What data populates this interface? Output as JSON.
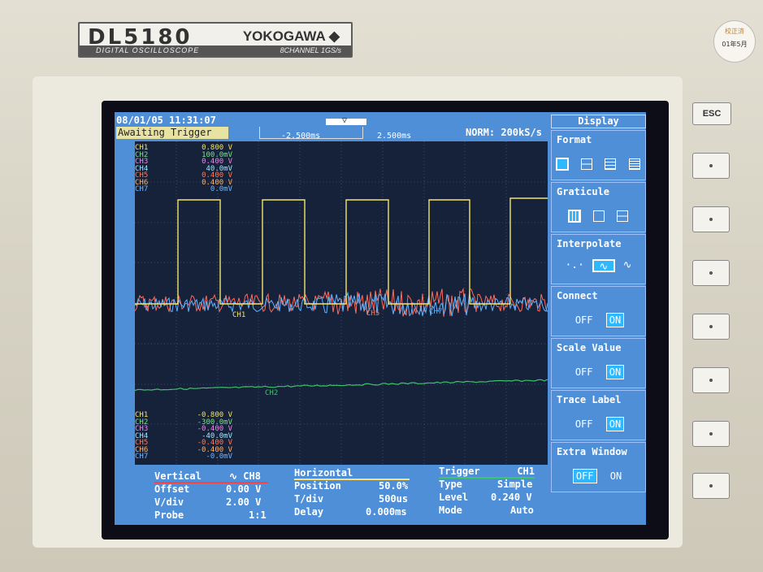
{
  "device": {
    "model": "DL5180",
    "maker": "YOKOGAWA",
    "subtitle_left": "DIGITAL OSCILLOSCOPE",
    "subtitle_right": "8CHANNEL 1GS/s",
    "sticker_lines": [
      "校正済",
      "01年5月"
    ],
    "esc_label": "ESC"
  },
  "header": {
    "datetime": "08/01/05 11:31:07",
    "status": "Awaiting Trigger",
    "time_left": "-2.500ms",
    "time_right": "2.500ms",
    "acq": "NORM: 200kS/s"
  },
  "top_channels": [
    {
      "name": "CH1",
      "value": "0.800 V",
      "color": "#f2e46a"
    },
    {
      "name": "CH2",
      "value": "100.0mV",
      "color": "#7ee08a"
    },
    {
      "name": "CH3",
      "value": "0.400 V",
      "color": "#e98be6"
    },
    {
      "name": "CH4",
      "value": "40.0mV",
      "color": "#9fe8ff"
    },
    {
      "name": "CH5",
      "value": "0.400 V",
      "color": "#ff7b55"
    },
    {
      "name": "CH6",
      "value": "0.400 V",
      "color": "#ffb36a"
    },
    {
      "name": "CH7",
      "value": "0.0mV",
      "color": "#6fb8ff"
    }
  ],
  "bottom_channels": [
    {
      "name": "CH1",
      "value": "-0.800 V",
      "color": "#f2e46a"
    },
    {
      "name": "CH2",
      "value": "-300.0mV",
      "color": "#7ee08a"
    },
    {
      "name": "CH3",
      "value": "-0.400 V",
      "color": "#e98be6"
    },
    {
      "name": "CH4",
      "value": "-40.0mV",
      "color": "#9fe8ff"
    },
    {
      "name": "CH5",
      "value": "-0.400 V",
      "color": "#ff7b55"
    },
    {
      "name": "CH6",
      "value": "-0.400 V",
      "color": "#ffb36a"
    },
    {
      "name": "CH7",
      "value": "-0.0mV",
      "color": "#6fb8ff"
    }
  ],
  "trace_labels": {
    "ch1": "CH1",
    "ch5": "CH5",
    "ch7": "CH7",
    "ch2": "CH2"
  },
  "sidebar": {
    "title": "Display",
    "format": {
      "label": "Format"
    },
    "graticule": {
      "label": "Graticule"
    },
    "interpolate": {
      "label": "Interpolate"
    },
    "connect": {
      "label": "Connect",
      "off": "OFF",
      "on": "ON",
      "selected": "ON"
    },
    "scale_value": {
      "label": "Scale Value",
      "off": "OFF",
      "on": "ON",
      "selected": "ON"
    },
    "trace_label": {
      "label": "Trace Label",
      "off": "OFF",
      "on": "ON",
      "selected": "ON"
    },
    "extra_window": {
      "label": "Extra Window",
      "off": "OFF",
      "on": "ON",
      "selected": "OFF"
    }
  },
  "vertical": {
    "title": "Vertical",
    "channel": "CH8",
    "offset_label": "Offset",
    "offset": "0.00 V",
    "vdiv_label": "V/div",
    "vdiv": "2.00 V",
    "probe_label": "Probe",
    "probe": "1:1"
  },
  "horizontal": {
    "title": "Horizontal",
    "position_label": "Position",
    "position": "50.0%",
    "tdiv_label": "T/div",
    "tdiv": "500us",
    "delay_label": "Delay",
    "delay": "0.000ms"
  },
  "trigger": {
    "title": "Trigger",
    "source": "CH1",
    "type_label": "Type",
    "type": "Simple",
    "level_label": "Level",
    "level": "0.240 V",
    "mode_label": "Mode",
    "mode": "Auto"
  },
  "colors": {
    "lcd": "#4f8fd8",
    "grid_bg": "#16213a",
    "ch1": "#f2e46a",
    "ch2": "#3ec46a",
    "noise_red": "#ff6b5a",
    "noise_blue": "#5fb3ff"
  }
}
